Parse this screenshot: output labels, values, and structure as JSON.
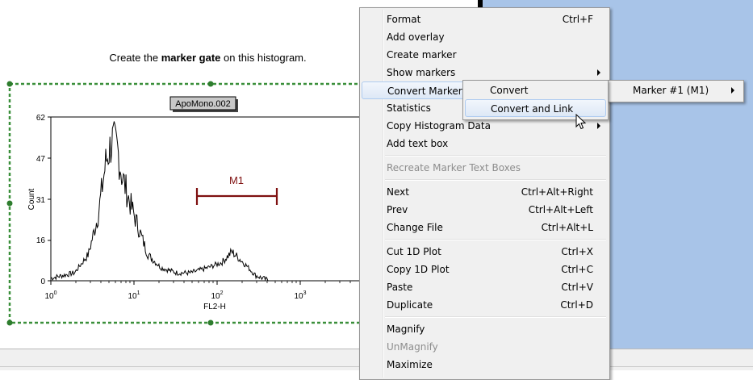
{
  "instruction": {
    "prefix": "Create the ",
    "bold": "marker gate",
    "suffix": " on this histogram."
  },
  "plot": {
    "sample_label": "ApoMono.002",
    "ylabel": "Count",
    "xlabel": "FL2-H",
    "y_ticks": [
      "0",
      "16",
      "31",
      "47",
      "62"
    ],
    "x_ticks": [
      {
        "base": "10",
        "exp": "0"
      },
      {
        "base": "10",
        "exp": "1"
      },
      {
        "base": "10",
        "exp": "2"
      },
      {
        "base": "10",
        "exp": "3"
      }
    ],
    "marker_label": "M1",
    "colors": {
      "marker": "#7f1010",
      "gate_dash": "#3a8f3a",
      "handle": "#2e7d2e"
    }
  },
  "chart_data": {
    "type": "line",
    "x_scale": "log",
    "xlim": [
      1,
      10000
    ],
    "ylim": [
      0,
      62
    ],
    "xlabel": "FL2-H",
    "ylabel": "Count",
    "x": [
      1,
      2,
      3,
      4,
      5,
      6,
      7,
      8,
      10,
      13,
      17,
      25,
      40,
      60,
      100,
      150,
      200,
      300,
      400,
      600
    ],
    "y": [
      1,
      3,
      10,
      25,
      45,
      53,
      50,
      40,
      30,
      20,
      10,
      5,
      3,
      3,
      5,
      7,
      11,
      6,
      2,
      0
    ],
    "annotations": [
      {
        "text": "M1",
        "type": "marker-range",
        "x_range": [
          60,
          600
        ]
      }
    ]
  },
  "context_menu": {
    "items": [
      {
        "label": "Format",
        "shortcut": "Ctrl+F"
      },
      {
        "label": "Add overlay",
        "shortcut": ""
      },
      {
        "label": "Create marker",
        "shortcut": ""
      },
      {
        "label": "Show markers",
        "shortcut": "",
        "submenu": true
      },
      {
        "label": "Convert Marker to",
        "shortcut": "",
        "submenu": true,
        "highlighted": true
      },
      {
        "label": "Statistics",
        "shortcut": ""
      },
      {
        "label": "Copy Histogram Data",
        "shortcut": "",
        "submenu": true
      },
      {
        "label": "Add text box",
        "shortcut": ""
      },
      {
        "separator": true
      },
      {
        "label": "Recreate Marker Text Boxes",
        "shortcut": "",
        "disabled": true
      },
      {
        "separator": true
      },
      {
        "label": "Next",
        "shortcut": "Ctrl+Alt+Right"
      },
      {
        "label": "Prev",
        "shortcut": "Ctrl+Alt+Left"
      },
      {
        "label": "Change File",
        "shortcut": "Ctrl+Alt+L"
      },
      {
        "separator": true
      },
      {
        "label": "Cut 1D Plot",
        "shortcut": "Ctrl+X"
      },
      {
        "label": "Copy 1D Plot",
        "shortcut": "Ctrl+C"
      },
      {
        "label": "Paste",
        "shortcut": "Ctrl+V"
      },
      {
        "label": "Duplicate",
        "shortcut": "Ctrl+D"
      },
      {
        "separator": true
      },
      {
        "label": "Magnify",
        "shortcut": ""
      },
      {
        "label": "UnMagnify",
        "shortcut": "",
        "disabled": true
      },
      {
        "label": "Maximize",
        "shortcut": ""
      }
    ]
  },
  "submenu_marker": {
    "items": [
      {
        "label": "Marker #1 (M1)",
        "submenu": true
      }
    ]
  },
  "submenu_convert": {
    "items": [
      {
        "label": "Convert"
      },
      {
        "label": "Convert and Link",
        "highlighted": true
      }
    ]
  }
}
